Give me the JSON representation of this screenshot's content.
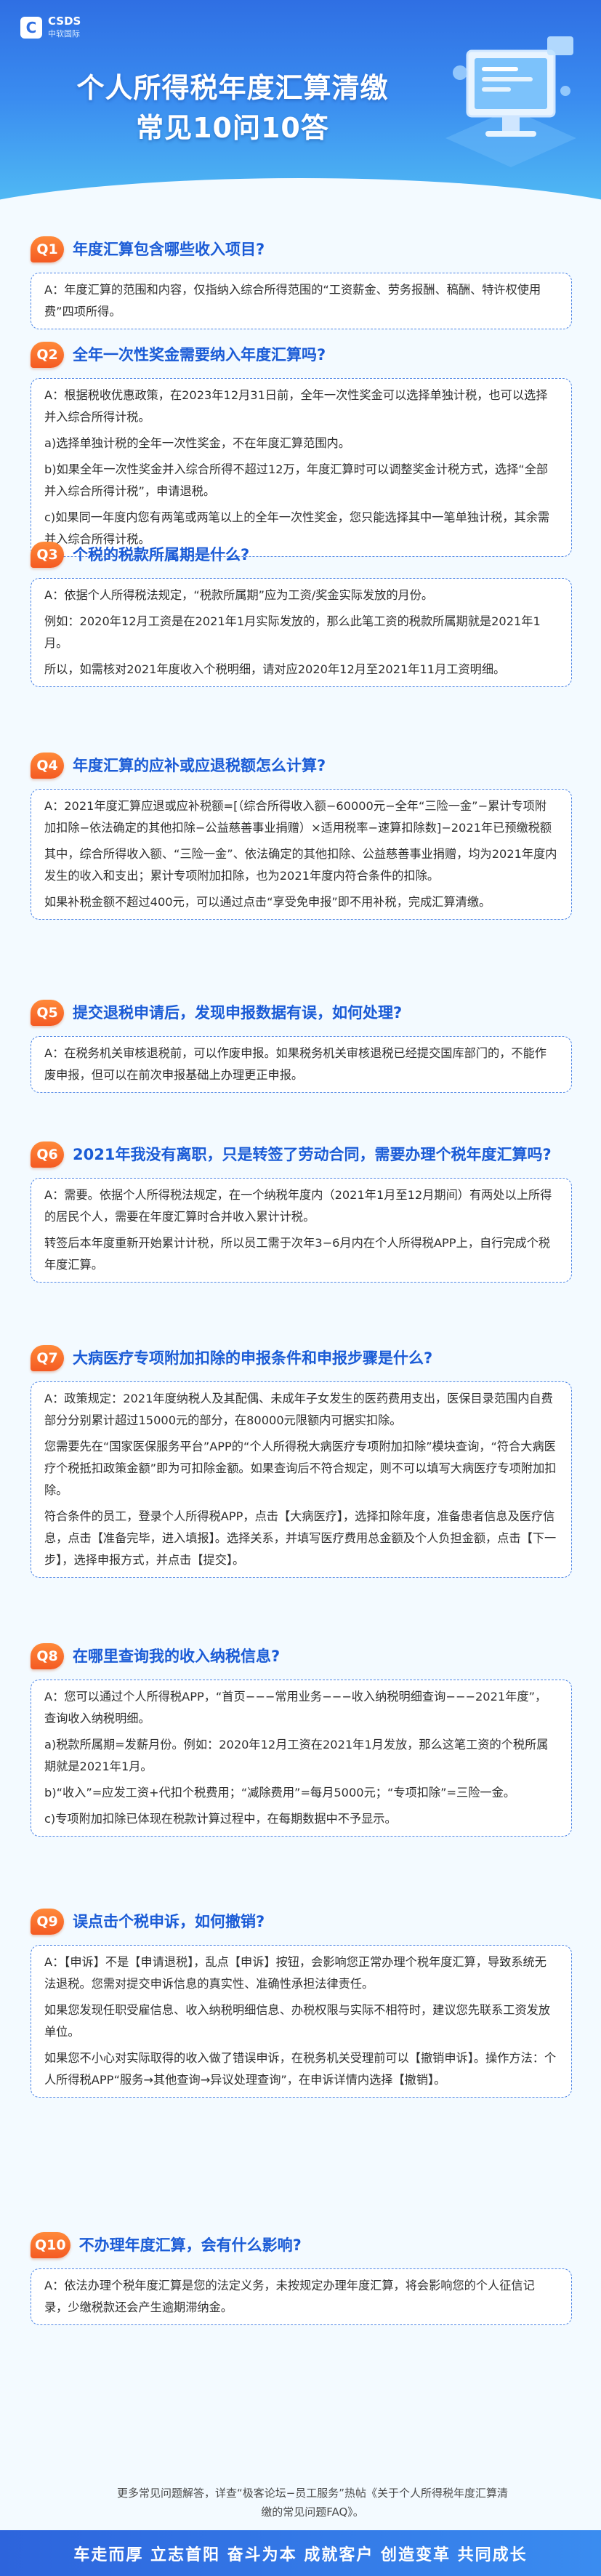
{
  "header": {
    "logo_mark": "C",
    "logo_name": "CSDS",
    "logo_sub": "中软国际",
    "title_line1": "个人所得税年度汇算清缴",
    "title_line2": "常见10问10答"
  },
  "qas": [
    {
      "badge": "Q1",
      "question": "年度汇算包含哪些收入项目?",
      "answer": [
        "A：年度汇算的范围和内容，仅指纳入综合所得范围的“工资薪金、劳务报酬、稿酬、特许权使用费”四项所得。"
      ]
    },
    {
      "badge": "Q2",
      "question": "全年一次性奖金需要纳入年度汇算吗?",
      "answer": [
        "A：根据税收优惠政策，在2023年12月31日前，全年一次性奖金可以选择单独计税，也可以选择并入综合所得计税。",
        "a)选择单独计税的全年一次性奖金，不在年度汇算范围内。",
        "b)如果全年一次性奖金并入综合所得不超过12万，年度汇算时可以调整奖金计税方式，选择“全部并入综合所得计税”，申请退税。",
        "c)如果同一年度内您有两笔或两笔以上的全年一次性奖金，您只能选择其中一笔单独计税，其余需并入综合所得计税。"
      ]
    },
    {
      "badge": "Q3",
      "question": "个税的税款所属期是什么?",
      "answer": [
        "A：依据个人所得税法规定，“税款所属期”应为工资/奖金实际发放的月份。",
        "例如：2020年12月工资是在2021年1月实际发放的，那么此笔工资的税款所属期就是2021年1月。",
        "所以，如需核对2021年度收入个税明细，请对应2020年12月至2021年11月工资明细。"
      ]
    },
    {
      "badge": "Q4",
      "question": "年度汇算的应补或应退税额怎么计算?",
      "answer": [
        "A：2021年度汇算应退或应补税额=[（综合所得收入额−60000元−全年“三险一金”−累计专项附加扣除−依法确定的其他扣除−公益慈善事业捐赠）×适用税率−速算扣除数]−2021年已预缴税额",
        "其中，综合所得收入额、“三险一金”、依法确定的其他扣除、公益慈善事业捐赠，均为2021年度内发生的收入和支出；累计专项附加扣除，也为2021年度内符合条件的扣除。",
        "如果补税金额不超过400元，可以通过点击“享受免申报”即不用补税，完成汇算清缴。"
      ]
    },
    {
      "badge": "Q5",
      "question": "提交退税申请后，发现申报数据有误，如何处理?",
      "answer": [
        "A：在税务机关审核退税前，可以作废申报。如果税务机关审核退税已经提交国库部门的，不能作废申报，但可以在前次申报基础上办理更正申报。"
      ]
    },
    {
      "badge": "Q6",
      "question": "2021年我没有离职，只是转签了劳动合同，需要办理个税年度汇算吗?",
      "answer": [
        "A：需要。依据个人所得税法规定，在一个纳税年度内（2021年1月至12月期间）有两处以上所得的居民个人，需要在年度汇算时合并收入累计计税。",
        "转签后本年度重新开始累计计税，所以员工需于次年3−6月内在个人所得税APP上，自行完成个税年度汇算。"
      ]
    },
    {
      "badge": "Q7",
      "question": "大病医疗专项附加扣除的申报条件和申报步骤是什么?",
      "answer": [
        "A：政策规定：2021年度纳税人及其配偶、未成年子女发生的医药费用支出，医保目录范围内自费部分分别累计超过15000元的部分，在80000元限额内可据实扣除。",
        "您需要先在“国家医保服务平台”APP的“个人所得税大病医疗专项附加扣除”模块查询，“符合大病医疗个税抵扣政策金额”即为可扣除金额。如果查询后不符合规定，则不可以填写大病医疗专项附加扣除。",
        "符合条件的员工，登录个人所得税APP，点击【大病医疗】，选择扣除年度，准备患者信息及医疗信息，点击【准备完毕，进入填报】。选择关系，并填写医疗费用总金额及个人负担金额，点击【下一步】，选择申报方式，并点击【提交】。"
      ]
    },
    {
      "badge": "Q8",
      "question": "在哪里查询我的收入纳税信息?",
      "answer": [
        "A：您可以通过个人所得税APP，“首页−−−常用业务−−−收入纳税明细查询−−−2021年度”，查询收入纳税明细。",
        "a)税款所属期=发薪月份。例如：2020年12月工资在2021年1月发放，那么这笔工资的个税所属期就是2021年1月。",
        "b)“收入”=应发工资+代扣个税费用；“减除费用”=每月5000元；“专项扣除”=三险一金。",
        "c)专项附加扣除已体现在税款计算过程中，在每期数据中不予显示。"
      ]
    },
    {
      "badge": "Q9",
      "question": "误点击个税申诉，如何撤销?",
      "answer": [
        "A：【申诉】不是【申请退税】，乱点【申诉】按钮，会影响您正常办理个税年度汇算，导致系统无法退税。您需对提交申诉信息的真实性、准确性承担法律责任。",
        "如果您发现任职受雇信息、收入纳税明细信息、办税权限与实际不相符时，建议您先联系工资发放单位。",
        "如果您不小心对实际取得的收入做了错误申诉，在税务机关受理前可以【撤销申诉】。操作方法：个人所得税APP“服务→其他查询→异议处理查询”，在申诉详情内选择【撤销】。"
      ]
    },
    {
      "badge": "Q10",
      "question": "不办理年度汇算，会有什么影响?",
      "answer": [
        "A：依法办理个税年度汇算是您的法定义务，未按规定办理年度汇算，将会影响您的个人征信记录，少缴税款还会产生逾期滞纳金。"
      ]
    }
  ],
  "footer": {
    "note": "更多常见问题解答，详查“极客论坛−员工服务”热帖《关于个人所得税年度汇算清缴的常见问题FAQ》。",
    "slogan": "车走而厚 立志首阳 奋斗为本 成就客户 创造变革 共同成长"
  },
  "colors": {
    "accent": "#1a5bd6",
    "badge": "#f45a22",
    "header_top": "#2f6fe3",
    "header_bottom": "#53c0f4"
  }
}
